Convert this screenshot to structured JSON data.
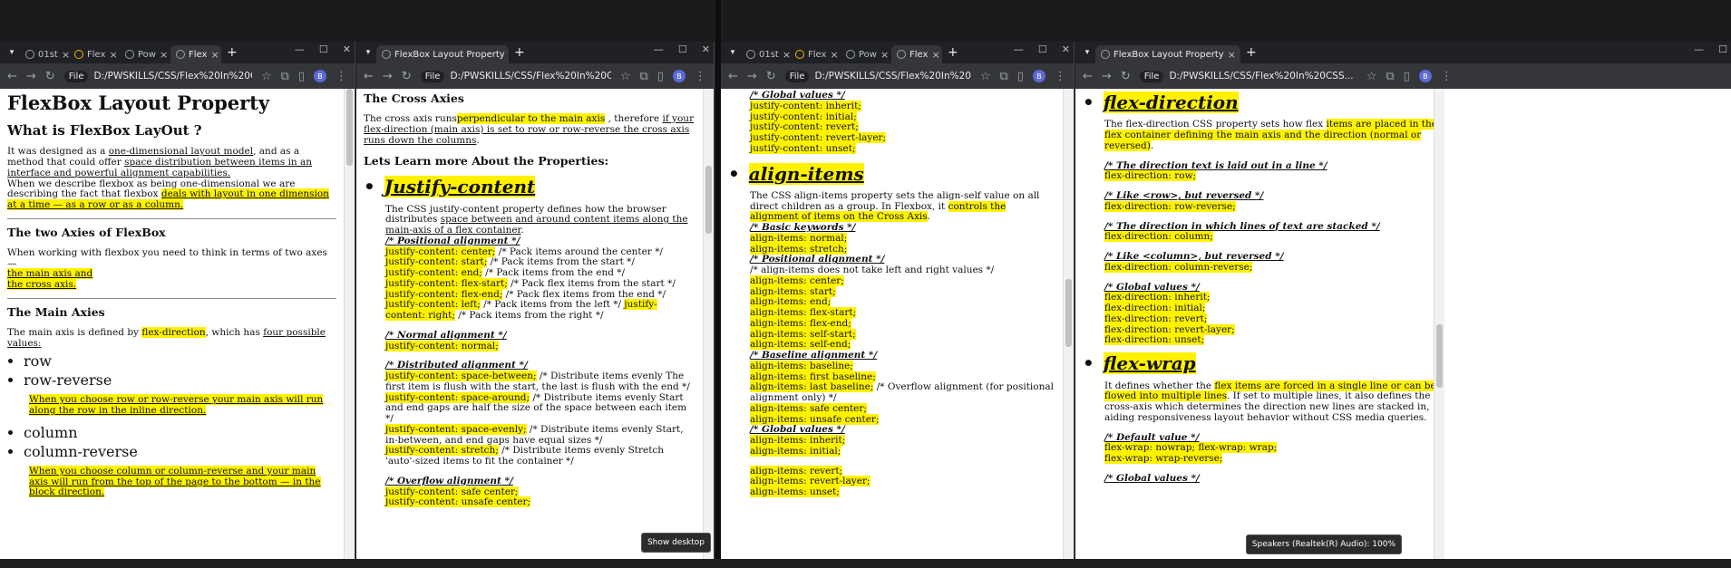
{
  "win1": {
    "tabs": [
      "01st",
      "Flex",
      "Pow",
      "Flex"
    ],
    "url": "D:/PWSKILLS/CSS/Flex%20In%20CSS...",
    "chip": "File",
    "avatar": "B",
    "title": "FlexBox Layout Property",
    "what_heading": "What is FlexBox LayOut ?",
    "p1_a": "It was designed as a ",
    "p1_u1": "one-dimensional layout model",
    "p1_b": ", and as a method that could offer ",
    "p1_u2": "space distribution between items in an interface and powerful alignment capabilities.",
    "p1_c": "When we describe flexbox as being one-dimensional we are describing the fact that flexbox ",
    "p1_hl": "deals with layout in one dimension at a time — as a row or as a column.",
    "axes_heading": "The two Axies of FlexBox",
    "axes_p": "When working with flexbox you need to think in terms of two axes —",
    "axes_l1": "the main axis and",
    "axes_l2": "the cross axis.",
    "main_heading": "The Main Axies",
    "main_p_a": "The main axis is defined by ",
    "main_p_hl": "flex-direction",
    "main_p_b": ", which has ",
    "main_p_u": "four possible values:",
    "vals1": [
      "row",
      "row-reverse"
    ],
    "note1": "When you choose row or row-reverse your main axis will run along the row in the inline direction.",
    "vals2": [
      "column",
      "column-reverse"
    ],
    "note2": "When you choose column or column-reverse and your main axis will run from the top of the page to the bottom — in the block direction."
  },
  "win2": {
    "tab": "FlexBox Layout Property",
    "url": "D:/PWSKILLS/CSS/Flex%20In%20CSS...",
    "chip": "File",
    "avatar": "B",
    "cross_heading": "The Cross Axies",
    "cross_a": "The cross axis runs",
    "cross_hl": "perpendicular to the main axis",
    "cross_b": " , therefore ",
    "cross_u": "if your flex-direction (main axis) is set to row or row-reverse the cross axis runs down the columns",
    "cross_c": ".",
    "learn_heading": "Lets Learn more About the Properties:",
    "jc_title": "Justify-content",
    "jc_desc_a": "The CSS justify-content property defines how the browser distributes ",
    "jc_desc_u": "space between and around content items along the main-axis of a flex container",
    "jc_desc_b": ".",
    "pos_label": "/* Positional alignment */",
    "pos_lines": [
      [
        "justify-content: center;",
        " /* Pack items around the center */"
      ],
      [
        "justify-content: start;",
        " /* Pack items from the start */"
      ],
      [
        "justify-content: end;",
        " /* Pack items from the end */"
      ],
      [
        "justify-content: flex-start;",
        " /* Pack flex items from the start */"
      ],
      [
        "justify-content: flex-end;",
        " /* Pack flex items from the end */"
      ]
    ],
    "pos_left": "justify-content: left;",
    "pos_left_c": " /* Pack items from the left */ ",
    "pos_right": "justify-content: right;",
    "pos_right_c": " /* Pack items from the right */",
    "normal_label": "/* Normal alignment */",
    "normal_line": "justify-content: normal;",
    "dist_label": "/* Distributed alignment */",
    "dist_lines": [
      [
        "justify-content: space-between;",
        " /* Distribute items evenly The first item is flush with the start, the last is flush with the end */"
      ],
      [
        "justify-content: space-around;",
        " /* Distribute items evenly Start and end gaps are half the size of the space between each item */"
      ],
      [
        "justify-content: space-evenly;",
        " /* Distribute items evenly Start, in-between, and end gaps have equal sizes */"
      ],
      [
        "justify-content: stretch;",
        " /* Distribute items evenly Stretch 'auto'-sized items to fit the container */"
      ]
    ],
    "over_label": "/* Overflow alignment */",
    "over_lines": [
      "justify-content: safe center;",
      "justify-content: unsafe center;"
    ],
    "tooltip": "Show desktop"
  },
  "win3": {
    "tabs": [
      "01st",
      "Flex",
      "Pow",
      "Flex"
    ],
    "url": "D:/PWSKILLS/CSS/Flex%20In%20CSS...",
    "chip": "File",
    "avatar": "B",
    "glob_label": "/* Global values */",
    "glob_lines": [
      "justify-content: inherit;",
      "justify-content: initial;",
      "justify-content: revert;",
      "justify-content: revert-layer;",
      "justify-content: unset;"
    ],
    "ai_title": "align-items",
    "ai_desc_a": "The CSS align-items property sets the align-self value on all direct children as a group. In Flexbox, it ",
    "ai_desc_hl": "controls the alignment of items on the Cross Axis",
    "ai_desc_b": ".",
    "basic_label": "/* Basic keywords */",
    "basic_lines": [
      "align-items: normal;",
      "align-items: stretch;"
    ],
    "pos_label": "/* Positional alignment */",
    "pos_note": "/* align-items does not take left and right values */",
    "pos_lines": [
      "align-items: center;",
      "align-items: start;",
      "align-items: end;",
      "align-items: flex-start;",
      "align-items: flex-end;",
      "align-items: self-start;",
      "align-items: self-end;"
    ],
    "base_label": "/* Baseline alignment */",
    "base_lines": [
      "align-items: baseline;",
      "align-items: first baseline;"
    ],
    "base_last": "align-items: last baseline;",
    "base_last_c": " /* Overflow alignment (for positional alignment only) */",
    "safe_lines": [
      "align-items: safe center;",
      "align-items: unsafe center;"
    ],
    "glob2_label": "/* Global values */",
    "glob2_lines": [
      "align-items: inherit;",
      "align-items: initial;"
    ],
    "glob3_lines": [
      "align-items: revert;",
      "align-items: revert-layer;",
      "align-items: unset;"
    ]
  },
  "win4": {
    "tab": "FlexBox Layout Property",
    "url": "D:/PWSKILLS/CSS/Flex%20In%20CSS...",
    "chip": "File",
    "avatar": "B",
    "fd_title": "flex-direction",
    "fd_desc_a": "The flex-direction CSS property sets how flex ",
    "fd_desc_hl": "items are placed in the flex container defining the main axis and the direction (normal or reversed)",
    "fd_desc_b": ".",
    "fd_groups": [
      {
        "label": "/* The direction text is laid out in a line */",
        "lines": [
          "flex-direction: row;"
        ]
      },
      {
        "label": "/* Like <row>, but reversed */",
        "lines": [
          "flex-direction: row-reverse;"
        ]
      },
      {
        "label": "/* The direction in which lines of text are stacked */",
        "lines": [
          "flex-direction: column;"
        ]
      },
      {
        "label": "/* Like <column>, but reversed */",
        "lines": [
          "flex-direction: column-reverse;"
        ]
      },
      {
        "label": "/* Global values */",
        "lines": [
          "flex-direction: inherit;",
          "flex-direction: initial;",
          "flex-direction: revert;",
          "flex-direction: revert-layer;",
          "flex-direction: unset;"
        ]
      }
    ],
    "fw_title": "flex-wrap",
    "fw_desc_a": "It defines whether the ",
    "fw_desc_hl": "flex items are forced in a single line or can be flowed into multiple lines",
    "fw_desc_b": ". If set to multiple lines, it also defines the cross-axis which determines the direction new lines are stacked in, aiding responsiveness layout behavior without CSS media queries.",
    "fw_default_label": "/* Default value */",
    "fw_default_lines": [
      "flex-wrap: nowrap; flex-wrap: wrap;",
      "flex-wrap: wrap-reverse;"
    ],
    "fw_glob_label": "/* Global values */",
    "tooltip": "Speakers (Realtek(R) Audio): 100%"
  }
}
